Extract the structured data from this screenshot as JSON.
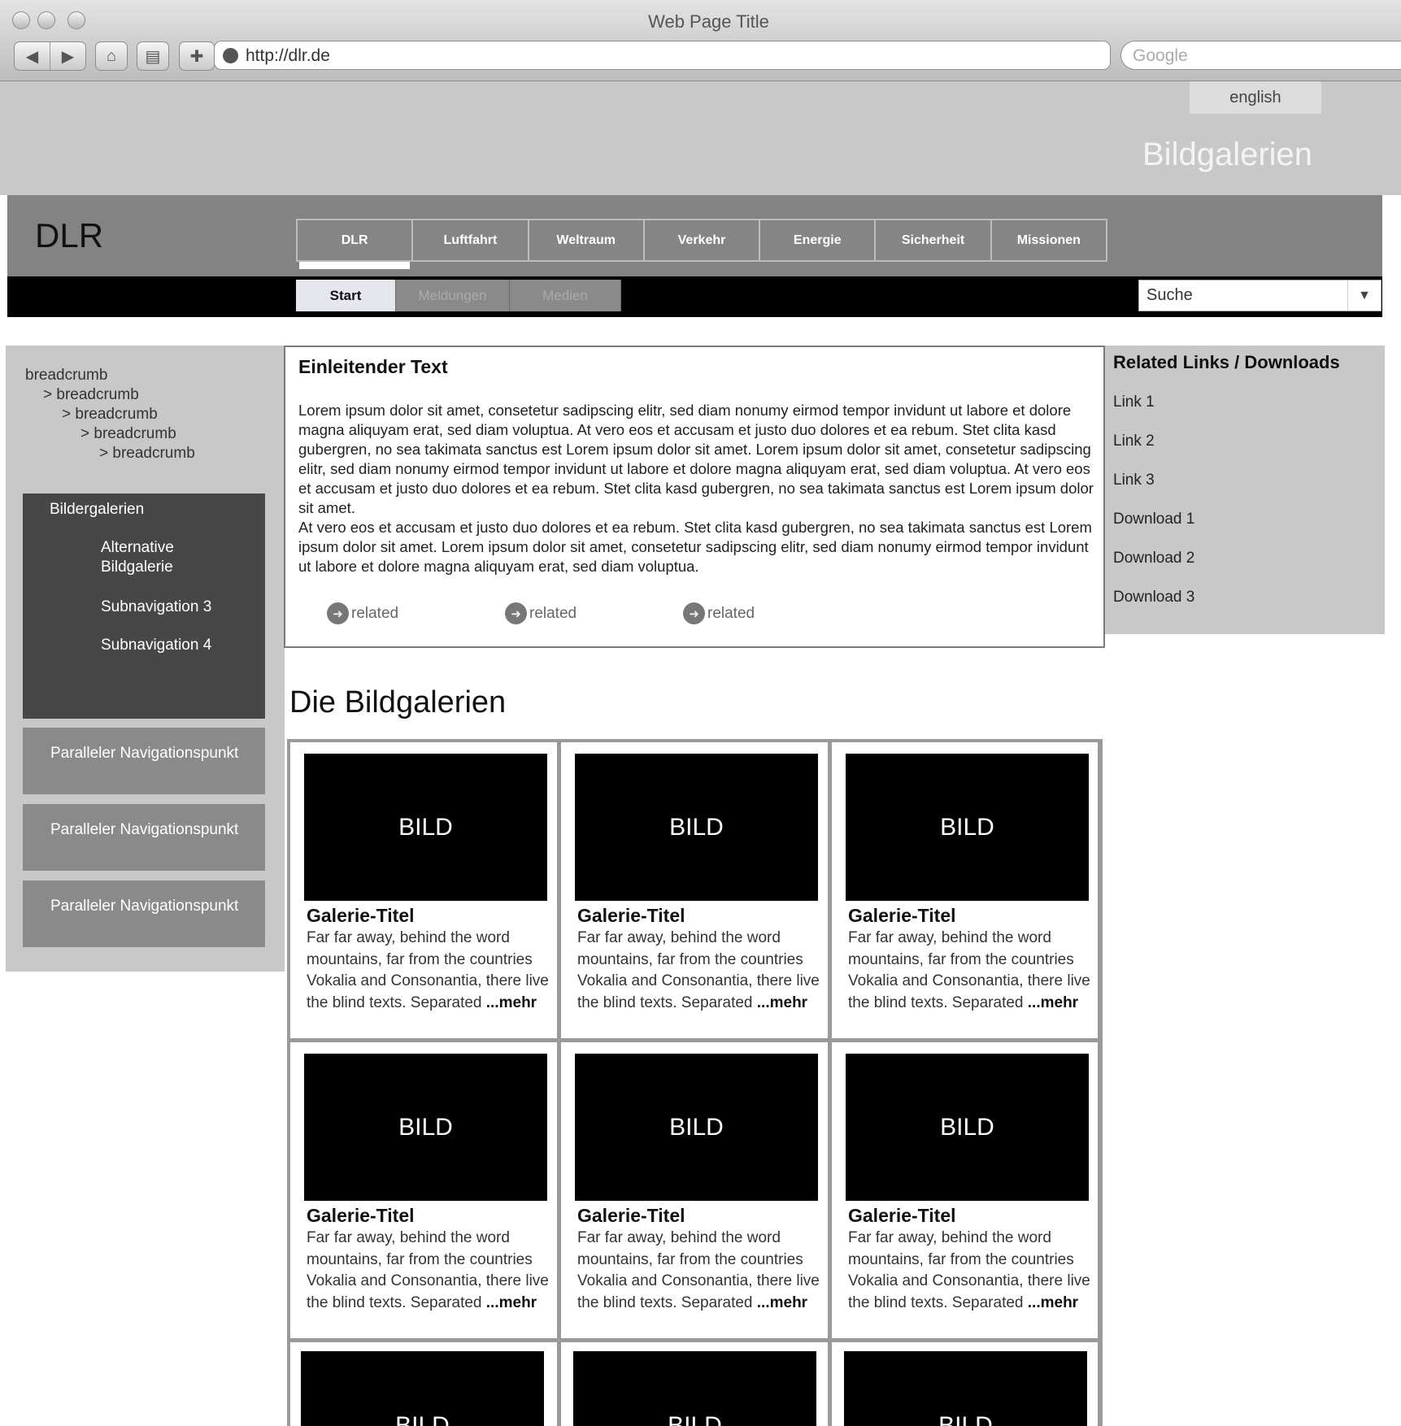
{
  "browser": {
    "window_title": "Web Page Title",
    "address": "http://dlr.de",
    "search_placeholder": "Google"
  },
  "header": {
    "language_link": "english",
    "page_title": "Bildgalerien"
  },
  "site": {
    "logo": "DLR",
    "main_tabs": [
      "DLR",
      "Luftfahrt",
      "Weltraum",
      "Verkehr",
      "Energie",
      "Sicherheit",
      "Missionen"
    ],
    "sub_tabs": [
      "Start",
      "Meldungen",
      "Medien"
    ],
    "search_value": "Suche"
  },
  "breadcrumbs": [
    "breadcrumb",
    "> breadcrumb",
    "> breadcrumb",
    "> breadcrumb",
    "> breadcrumb"
  ],
  "subnav": {
    "items": [
      "Bildergalerien",
      "Alternative Bildgalerie",
      "Subnavigation 3",
      "Subnavigation 4"
    ],
    "parallel": [
      "Paralleler Navigationspunkt",
      "Paralleler Navigationspunkt",
      "Paralleler Navigationspunkt"
    ]
  },
  "intro": {
    "heading": "Einleitender Text",
    "text": "Lorem ipsum dolor sit amet, consetetur sadipscing elitr, sed diam nonumy eirmod tempor invidunt ut labore et dolore magna aliquyam erat, sed diam voluptua. At vero eos et accusam et justo duo dolores et ea rebum. Stet clita kasd gubergren, no sea takimata sanctus est Lorem ipsum dolor sit amet. Lorem ipsum dolor sit amet, consetetur sadipscing elitr, sed diam nonumy eirmod tempor invidunt ut labore et dolore magna aliquyam erat, sed diam voluptua. At vero eos et accusam et justo duo dolores et ea rebum. Stet clita kasd gubergren, no sea takimata sanctus est Lorem ipsum dolor sit amet.",
    "text2": "At vero eos et accusam et justo duo dolores et ea rebum. Stet clita kasd gubergren, no sea takimata sanctus est Lorem ipsum dolor sit amet. Lorem ipsum dolor sit amet, consetetur sadipscing elitr, sed diam nonumy eirmod tempor invidunt ut labore et dolore magna aliquyam erat, sed diam voluptua.",
    "related": [
      "related",
      "related",
      "related"
    ]
  },
  "sidebar_right": {
    "heading": "Related Links / Downloads",
    "links": [
      "Link 1",
      "Link 2",
      "Link 3",
      "Download 1",
      "Download 2",
      "Download 3"
    ]
  },
  "gallery": {
    "heading": "Die Bildgalerien",
    "image_label": "BILD",
    "cards": [
      {
        "title": "Galerie-Titel",
        "text": "Far far away, behind the word mountains, far from the countries Vokalia and Consonantia, there live the blind texts. Separated",
        "more": "...mehr"
      },
      {
        "title": "Galerie-Titel",
        "text": "Far far away, behind the word mountains, far from the countries Vokalia and Consonantia, there live the blind texts. Separated",
        "more": "...mehr"
      },
      {
        "title": "Galerie-Titel",
        "text": "Far far away, behind the word mountains, far from the countries Vokalia and Consonantia, there live the blind texts. Separated",
        "more": "...mehr"
      },
      {
        "title": "Galerie-Titel",
        "text": "Far far away, behind the word mountains, far from the countries Vokalia and Consonantia, there live the blind texts. Separated",
        "more": "...mehr"
      },
      {
        "title": "Galerie-Titel",
        "text": "Far far away, behind the word mountains, far from the countries Vokalia and Consonantia, there live the blind texts. Separated",
        "more": "...mehr"
      },
      {
        "title": "Galerie-Titel",
        "text": "Far far away, behind the word mountains, far from the countries Vokalia and Consonantia, there live the blind texts. Separated",
        "more": "...mehr"
      }
    ]
  }
}
